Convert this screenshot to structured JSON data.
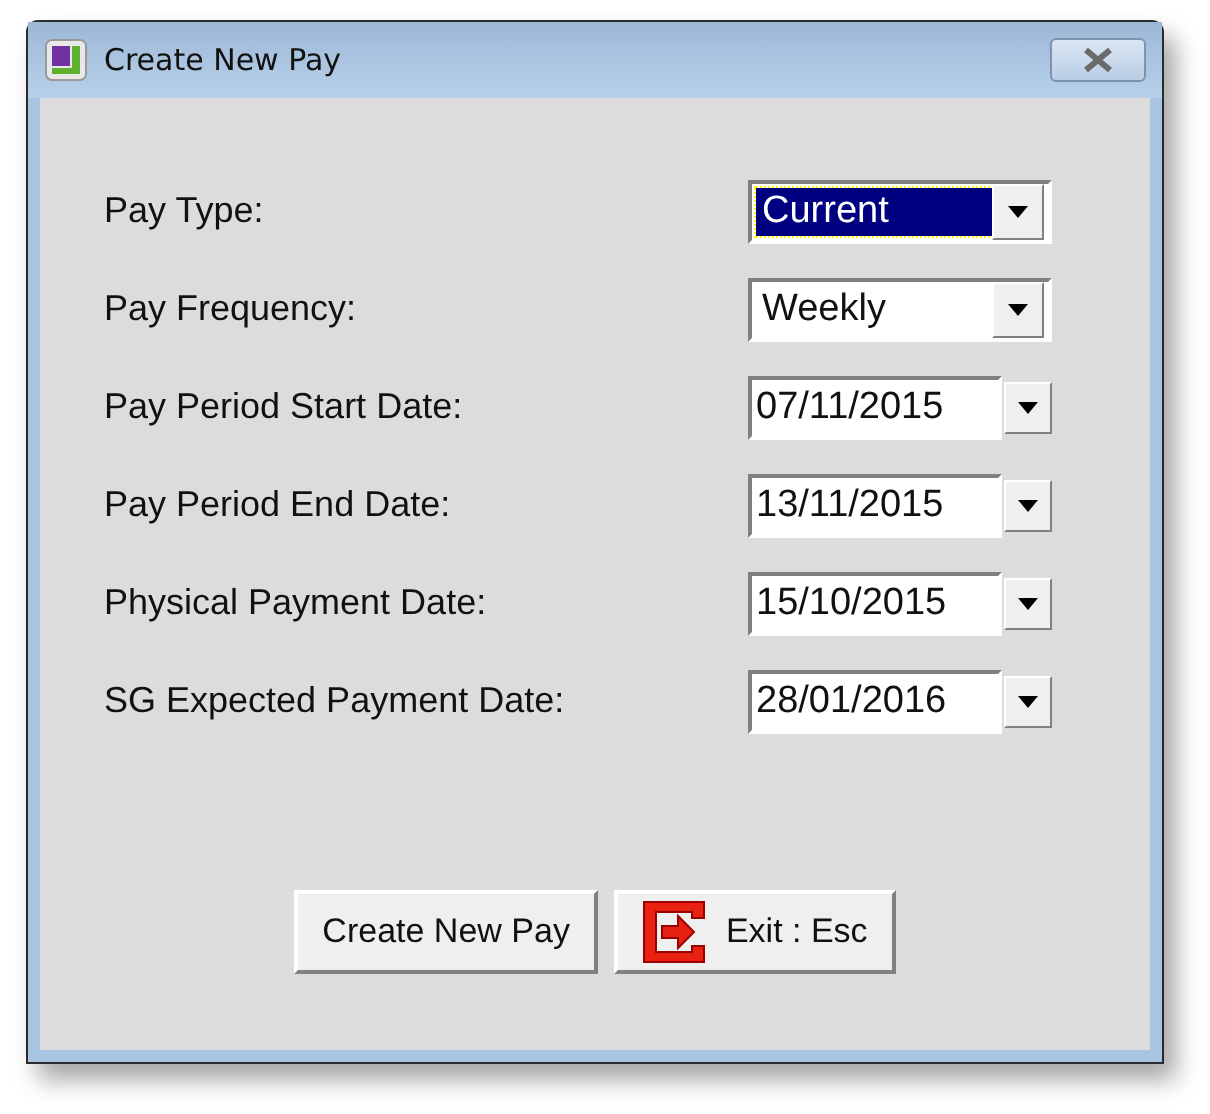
{
  "window": {
    "title": "Create New Pay"
  },
  "fields": [
    {
      "label": "Pay Type:",
      "kind": "combo",
      "value": "Current",
      "focused": true
    },
    {
      "label": "Pay Frequency:",
      "kind": "combo",
      "value": "Weekly",
      "focused": false
    },
    {
      "label": "Pay Period Start Date:",
      "kind": "date",
      "value": "07/11/2015",
      "focused": false
    },
    {
      "label": "Pay Period End Date:",
      "kind": "date",
      "value": "13/11/2015",
      "focused": false
    },
    {
      "label": "Physical Payment Date:",
      "kind": "date",
      "value": "15/10/2015",
      "focused": false
    },
    {
      "label": "SG Expected Payment Date:",
      "kind": "date",
      "value": "28/01/2016",
      "focused": false
    }
  ],
  "buttons": [
    {
      "label": "Create New Pay",
      "kind": "plain"
    },
    {
      "label": "Exit : Esc",
      "kind": "exit"
    }
  ]
}
